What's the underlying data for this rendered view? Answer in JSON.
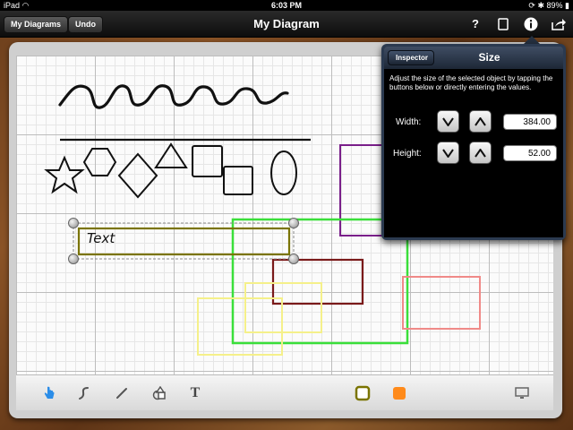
{
  "status_bar": {
    "carrier": "iPad",
    "time": "6:03 PM",
    "battery": "89%"
  },
  "nav": {
    "my_diagrams_label": "My Diagrams",
    "undo_label": "Undo",
    "title": "My Diagram",
    "help_icon": "question-mark-icon",
    "page_icon": "page-icon",
    "info_icon": "info-icon",
    "share_icon": "share-icon"
  },
  "canvas": {
    "text_label": "Text",
    "line_colors": [
      "#7a1f8a",
      "#3adf3a",
      "#7a1a1a",
      "#f5f08a",
      "#f08a88",
      "#7a7400"
    ]
  },
  "inspector": {
    "back_label": "Inspector",
    "title": "Size",
    "description": "Adjust the size of the selected object by tapping the buttons below or directly entering the values.",
    "width_label": "Width:",
    "width_value": "384.00",
    "height_label": "Height:",
    "height_value": "52.00",
    "decrease_glyph": "V",
    "increase_glyph": "Λ"
  },
  "toolbar": {
    "tools": [
      {
        "name": "select-hand-icon",
        "glyph": "☝"
      },
      {
        "name": "freehand-curve-icon",
        "glyph": "S"
      },
      {
        "name": "line-tool-icon",
        "glyph": "/"
      },
      {
        "name": "shapes-tool-icon",
        "glyph": "△"
      },
      {
        "name": "text-tool-icon",
        "glyph": "T"
      }
    ],
    "stroke_color": "#7a7400",
    "fill_color": "#ff8a1a",
    "present_icon": "monitor-icon"
  }
}
